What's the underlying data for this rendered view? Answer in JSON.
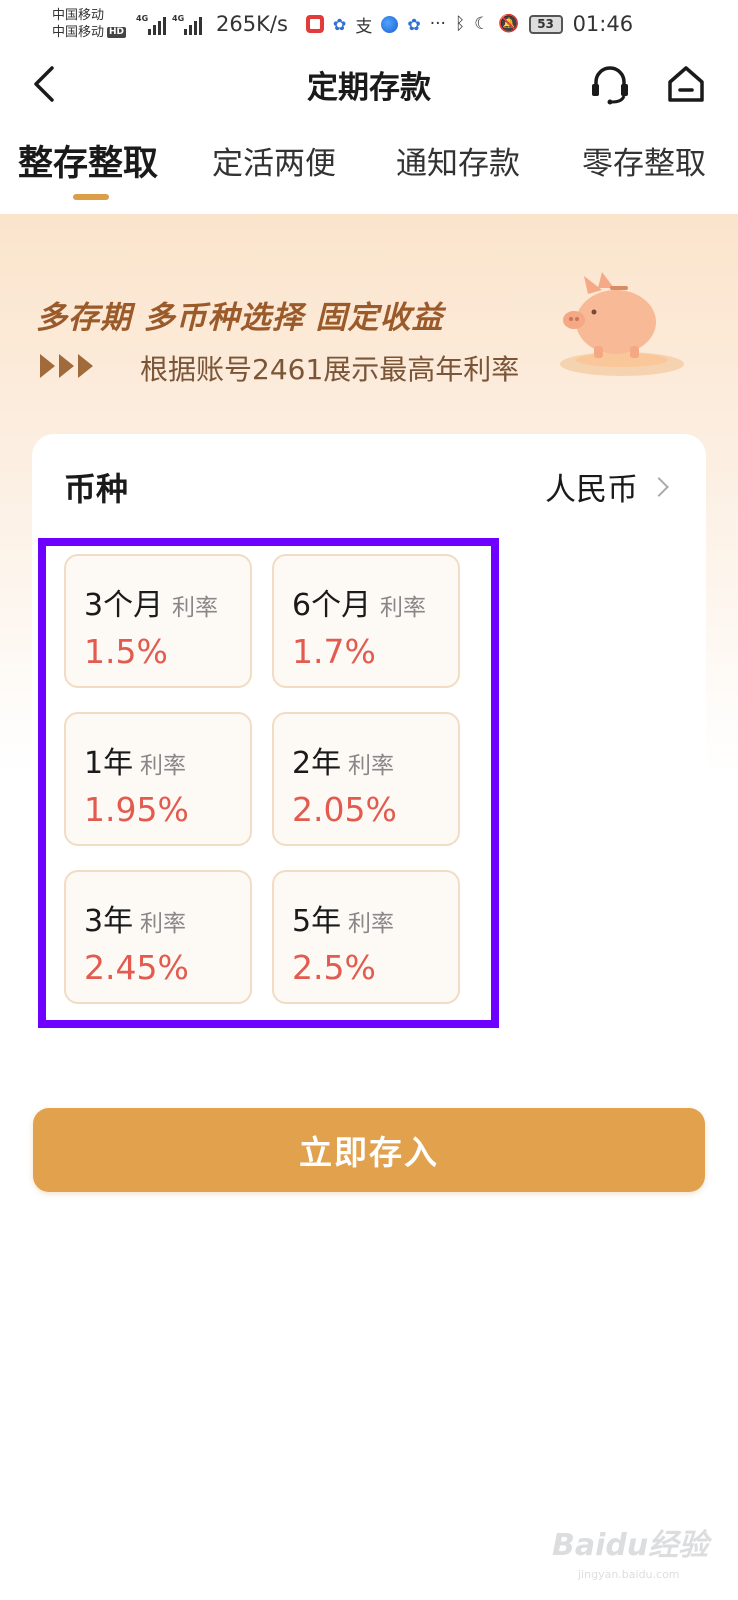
{
  "status_bar": {
    "carrier_1": "中国移动",
    "carrier_2": "中国移动",
    "hd": "HD",
    "network_1": "4G",
    "network_2": "4G",
    "speed": "265K/s",
    "alipay": "支",
    "more": "···",
    "battery": "53",
    "time": "01:46"
  },
  "header": {
    "title": "定期存款"
  },
  "tabs": [
    {
      "label": "整存整取",
      "active": true
    },
    {
      "label": "定活两便",
      "active": false
    },
    {
      "label": "通知存款",
      "active": false
    },
    {
      "label": "零存整取",
      "active": false
    }
  ],
  "banner": {
    "slogan": "多存期 多币种选择 固定收益",
    "rate_note": "根据账号2461展示最高年利率"
  },
  "currency": {
    "label": "币种",
    "value": "人民币"
  },
  "rates": [
    {
      "term": "3个月",
      "label": "利率",
      "value": "1.5%"
    },
    {
      "term": "6个月",
      "label": "利率",
      "value": "1.7%"
    },
    {
      "term": "1年",
      "label": "利率",
      "value": "1.95%"
    },
    {
      "term": "2年",
      "label": "利率",
      "value": "2.05%"
    },
    {
      "term": "3年",
      "label": "利率",
      "value": "2.45%"
    },
    {
      "term": "5年",
      "label": "利率",
      "value": "2.5%"
    }
  ],
  "cta": {
    "label": "立即存入"
  },
  "watermark": {
    "main": "Baidu经验",
    "sub": "jingyan.baidu.com"
  },
  "colors": {
    "accent": "#e1a14d",
    "rate_red": "#e35a4e",
    "highlight": "#6e00ff",
    "tab_indicator": "#dc9e48"
  }
}
